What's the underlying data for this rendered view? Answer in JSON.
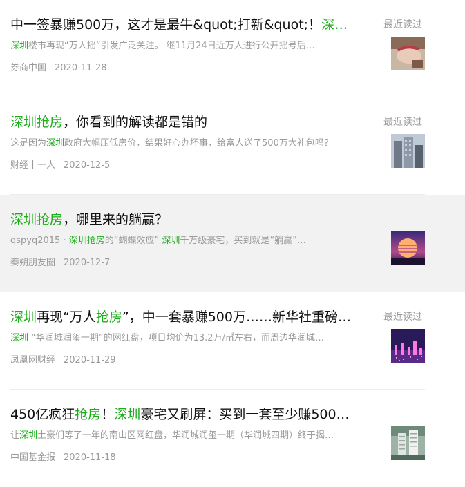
{
  "recent_label": "最近读过",
  "items": [
    {
      "title": [
        {
          "t": "中一签暴赚500万，这才是最牛&quot;打新&quot;！",
          "h": false
        },
        {
          "t": "深…",
          "h": true
        }
      ],
      "summary": [
        {
          "t": "深圳",
          "h": true
        },
        {
          "t": "楼市再现“万人摇”引发广泛关注。 继11月24日近万人进行公开摇号后…",
          "h": false
        }
      ],
      "source": "券商中国",
      "date": "2020-11-28",
      "show_recent": true,
      "thumb_icon": "hand-photo-icon"
    },
    {
      "title": [
        {
          "t": "深圳抢房",
          "h": true
        },
        {
          "t": "，你看到的解读都是错的",
          "h": false
        }
      ],
      "summary": [
        {
          "t": "这是因为",
          "h": false
        },
        {
          "t": "深圳",
          "h": true
        },
        {
          "t": "政府大幅压低房价，结果好心办坏事，给富人送了500万大礼包吗？",
          "h": false
        }
      ],
      "source": "财经十一人",
      "date": "2020-12-5",
      "show_recent": true,
      "thumb_icon": "building-photo-icon"
    },
    {
      "title": [
        {
          "t": "深圳抢房",
          "h": true
        },
        {
          "t": "，哪里来的躺赢？",
          "h": false
        }
      ],
      "summary": [
        {
          "t": "qspyq2015 · ",
          "h": false
        },
        {
          "t": "深圳抢房",
          "h": true
        },
        {
          "t": "的“蝴蝶效应” ",
          "h": false
        },
        {
          "t": "深圳",
          "h": true
        },
        {
          "t": "千万级豪宅，买到就是“躺赢”…",
          "h": false
        }
      ],
      "source": "秦朔朋友圈",
      "date": "2020-12-7",
      "show_recent": false,
      "thumb_icon": "sunset-photo-icon"
    },
    {
      "title": [
        {
          "t": "深圳",
          "h": true
        },
        {
          "t": "再现“万人",
          "h": false
        },
        {
          "t": "抢房",
          "h": true
        },
        {
          "t": "”，中一套暴赚500万……新华社重磅…",
          "h": false
        }
      ],
      "summary": [
        {
          "t": "深圳",
          "h": true
        },
        {
          "t": " “华润城润玺一期”的网红盘，项目均价为13.2万/㎡左右，而周边华润城…",
          "h": false
        }
      ],
      "source": "凤凰网财经",
      "date": "2020-11-29",
      "show_recent": true,
      "thumb_icon": "city-night-photo-icon"
    },
    {
      "title": [
        {
          "t": "450亿疯狂",
          "h": false
        },
        {
          "t": "抢房",
          "h": true
        },
        {
          "t": "！",
          "h": false
        },
        {
          "t": "深圳",
          "h": true
        },
        {
          "t": "豪宅又刷屏：买到一套至少赚500…",
          "h": false
        }
      ],
      "summary": [
        {
          "t": "让",
          "h": false
        },
        {
          "t": "深圳",
          "h": true
        },
        {
          "t": "土豪们等了一年的南山区网红盘，华润城润玺一期（华润城四期）终于揭…",
          "h": false
        }
      ],
      "source": "中国基金报",
      "date": "2020-11-18",
      "show_recent": false,
      "thumb_icon": "tower-photo-icon"
    }
  ]
}
